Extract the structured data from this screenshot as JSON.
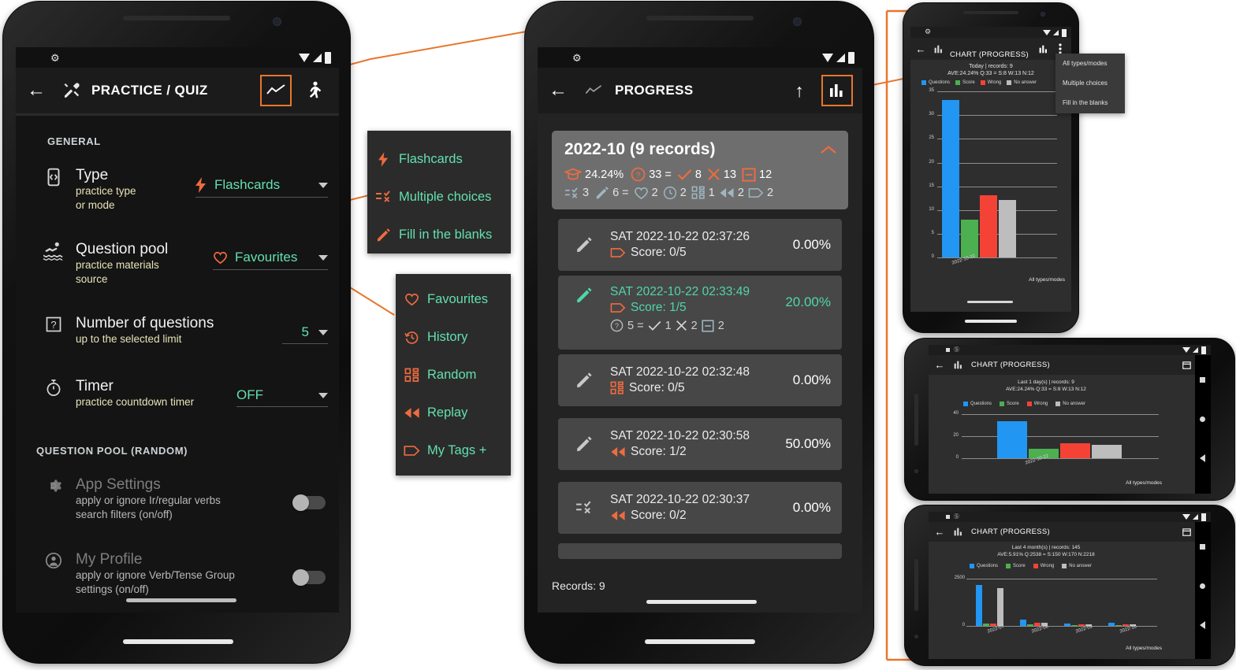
{
  "colors": {
    "accent_orange": "#e8762c",
    "teal_value": "#63e0b0",
    "questions_blue": "#2196f3",
    "score_green": "#4caf50",
    "wrong_red": "#f44336",
    "noanswer_grey": "#bdbdbd"
  },
  "phone_practice": {
    "statusbar": {
      "gear_icon": "gear-icon",
      "wifi_icon": "wifi-icon",
      "signal_icon": "signal-icon",
      "battery_icon": "battery-icon"
    },
    "appbar": {
      "back_icon": "back-arrow-icon",
      "tools_icon": "tools-icon",
      "title": "PRACTICE / QUIZ",
      "chart_icon": "line-chart-icon",
      "run_icon": "running-man-icon"
    },
    "section_general": "GENERAL",
    "rows": [
      {
        "icon": "flashcard-icon",
        "title": "Type",
        "sub": "practice type\nor mode",
        "value": "Flashcards",
        "value_icon": "lightning-icon",
        "has_caret": true
      },
      {
        "icon": "swimmer-icon",
        "title": "Question pool",
        "sub": "practice materials\nsource",
        "value": "Favourites",
        "value_icon": "heart-icon",
        "has_caret": true
      },
      {
        "icon": "question-box-icon",
        "title": "Number of questions",
        "sub": "up to the selected limit",
        "value": "5",
        "value_icon": "",
        "has_caret": true
      },
      {
        "icon": "stopwatch-icon",
        "title": "Timer",
        "sub": "practice countdown timer",
        "value": "OFF",
        "value_icon": "",
        "has_caret": true
      }
    ],
    "section_pool": "QUESTION POOL (RANDOM)",
    "toggles": [
      {
        "icon": "gear-icon",
        "title": "App Settings",
        "sub": "apply or ignore Ir/regular verbs\nsearch filters (on/off)",
        "state": "off"
      },
      {
        "icon": "person-icon",
        "title": "My Profile",
        "sub": "apply or ignore Verb/Tense Group\nsettings (on/off)",
        "state": "off"
      }
    ]
  },
  "menu_type": {
    "items": [
      {
        "icon": "lightning-icon",
        "label": "Flashcards"
      },
      {
        "icon": "multiple-choices-icon",
        "label": "Multiple choices"
      },
      {
        "icon": "pencil-icon",
        "label": "Fill in the blanks"
      }
    ]
  },
  "menu_pool": {
    "items": [
      {
        "icon": "heart-icon",
        "label": "Favourites"
      },
      {
        "icon": "history-icon",
        "label": "History"
      },
      {
        "icon": "random-icon",
        "label": "Random"
      },
      {
        "icon": "replay-icon",
        "label": "Replay"
      },
      {
        "icon": "tag-icon",
        "label": "My Tags +"
      }
    ]
  },
  "phone_progress": {
    "appbar": {
      "back_icon": "back-arrow-icon",
      "line_chart_icon": "line-chart-icon",
      "title": "PROGRESS",
      "up_icon": "up-arrow-icon",
      "bar_chart_icon": "bar-chart-icon"
    },
    "summary": {
      "header": "2022-10 (9 records)",
      "collapse_icon": "chevron-up-icon",
      "line1": [
        {
          "icon": "graduation-icon",
          "text": "24.24%"
        },
        {
          "icon": "question-circle-icon",
          "text": "33 ="
        },
        {
          "icon": "check-icon",
          "text": "8"
        },
        {
          "icon": "cross-icon",
          "text": "13"
        },
        {
          "icon": "minus-box-icon",
          "text": "12"
        }
      ],
      "line2": [
        {
          "icon": "multiple-choices-icon",
          "text": "3"
        },
        {
          "icon": "pencil-icon",
          "text": "6 ="
        },
        {
          "icon": "heart-icon",
          "text": "2"
        },
        {
          "icon": "history-icon",
          "text": "2"
        },
        {
          "icon": "random-icon",
          "text": "1"
        },
        {
          "icon": "replay-icon",
          "text": "2"
        },
        {
          "icon": "tag-icon",
          "text": "2"
        }
      ]
    },
    "records": [
      {
        "type_icon": "pencil-icon",
        "datetime": "SAT 2022-10-22 02:37:26",
        "source_icon": "tag-icon",
        "score": "Score: 0/5",
        "percent": "0.00%",
        "highlight": false
      },
      {
        "type_icon": "pencil-icon",
        "datetime": "SAT 2022-10-22 02:33:49",
        "source_icon": "tag-icon",
        "score": "Score: 1/5",
        "percent": "20.00%",
        "highlight": true,
        "detail": [
          {
            "icon": "question-circle-icon",
            "text": "5 ="
          },
          {
            "icon": "check-icon",
            "text": "1"
          },
          {
            "icon": "cross-icon",
            "text": "2"
          },
          {
            "icon": "minus-box-icon",
            "text": "2"
          }
        ]
      },
      {
        "type_icon": "pencil-icon",
        "datetime": "SAT 2022-10-22 02:32:48",
        "source_icon": "random-icon",
        "score": "Score: 0/5",
        "percent": "0.00%",
        "highlight": false
      },
      {
        "type_icon": "pencil-icon",
        "datetime": "SAT 2022-10-22 02:30:58",
        "source_icon": "replay-icon",
        "score": "Score: 1/2",
        "percent": "50.00%",
        "highlight": false
      },
      {
        "type_icon": "multiple-choices-icon",
        "datetime": "SAT 2022-10-22 02:30:37",
        "source_icon": "replay-icon",
        "score": "Score: 0/2",
        "percent": "0.00%",
        "highlight": false
      }
    ],
    "footer": "Records: 9"
  },
  "chart_menu": {
    "items": [
      "All types/modes",
      "Multiple choices",
      "Fill in the blanks"
    ]
  },
  "chart_phone_1": {
    "appbar": {
      "back_icon": "back-arrow-icon",
      "bar_chart_icon": "bar-chart-icon",
      "title": "CHART (PROGRESS)",
      "chart2_icon": "bar-chart-icon",
      "overflow_icon": "overflow-menu-icon"
    },
    "footer": "All types/modes"
  },
  "chart_phone_2": {
    "appbar": {
      "back_icon": "back-arrow-icon",
      "bar_chart_icon": "bar-chart-icon",
      "title": "CHART (PROGRESS)",
      "calendar_icon": "calendar-icon",
      "overflow_icon": "overflow-menu-icon"
    },
    "footer": "All types/modes",
    "nav": {
      "recent_icon": "recents-icon",
      "home_icon": "home-icon",
      "back_icon": "nav-back-icon"
    }
  },
  "chart_phone_3": {
    "appbar": {
      "back_icon": "back-arrow-icon",
      "bar_chart_icon": "bar-chart-icon",
      "title": "CHART (PROGRESS)",
      "calendar_icon": "calendar-icon",
      "overflow_icon": "overflow-menu-icon"
    },
    "footer": "All types/modes",
    "nav": {
      "recent_icon": "recents-icon",
      "home_icon": "home-icon",
      "back_icon": "nav-back-icon"
    }
  },
  "chart_data": [
    {
      "type": "bar",
      "title": "Today | records: 9",
      "subtitle": "AVE:24.24%  Q:33 = S:8 W:13 N:12",
      "categories": [
        "2022-10-22"
      ],
      "series": [
        {
          "name": "Questions",
          "values": [
            33
          ],
          "color": "#2196f3"
        },
        {
          "name": "Score",
          "values": [
            8
          ],
          "color": "#4caf50"
        },
        {
          "name": "Wrong",
          "values": [
            13
          ],
          "color": "#f44336"
        },
        {
          "name": "No answer",
          "values": [
            12
          ],
          "color": "#bdbdbd"
        }
      ],
      "yticks": [
        0,
        5,
        10,
        15,
        20,
        25,
        30,
        35
      ],
      "ylim": [
        0,
        35
      ],
      "grid": true,
      "legend": "top",
      "xlabel": "",
      "ylabel": "",
      "annotation": "All types/modes"
    },
    {
      "type": "bar",
      "title": "Last 1 day(s) | records: 9",
      "subtitle": "AVE:24.24%  Q:33 = S:8 W:13 N:12",
      "categories": [
        "2022-10-22"
      ],
      "series": [
        {
          "name": "Questions",
          "values": [
            33
          ],
          "color": "#2196f3"
        },
        {
          "name": "Score",
          "values": [
            8
          ],
          "color": "#4caf50"
        },
        {
          "name": "Wrong",
          "values": [
            13
          ],
          "color": "#f44336"
        },
        {
          "name": "No answer",
          "values": [
            12
          ],
          "color": "#bdbdbd"
        }
      ],
      "yticks": [
        0,
        20,
        40
      ],
      "ylim": [
        0,
        40
      ],
      "grid": true,
      "legend": "top",
      "xlabel": "",
      "ylabel": "",
      "annotation": "All types/modes"
    },
    {
      "type": "bar",
      "title": "Last 4 month(s) | records: 145",
      "subtitle": "AVE:5.91%  Q:2538 = S:150 W:170 N:2218",
      "categories": [
        "2022-07",
        "2022-08",
        "2022-09",
        "2022-10"
      ],
      "series": [
        {
          "name": "Questions",
          "values": [
            2160,
            270,
            80,
            110
          ],
          "color": "#2196f3"
        },
        {
          "name": "Score",
          "values": [
            90,
            40,
            20,
            25
          ],
          "color": "#4caf50"
        },
        {
          "name": "Wrong",
          "values": [
            70,
            110,
            35,
            30
          ],
          "color": "#f44336"
        },
        {
          "name": "No answer",
          "values": [
            2000,
            130,
            40,
            55
          ],
          "color": "#bdbdbd"
        }
      ],
      "yticks": [
        0,
        2500
      ],
      "ylim": [
        0,
        2500
      ],
      "grid": true,
      "legend": "top",
      "xlabel": "",
      "ylabel": "",
      "annotation": "All types/modes"
    }
  ]
}
